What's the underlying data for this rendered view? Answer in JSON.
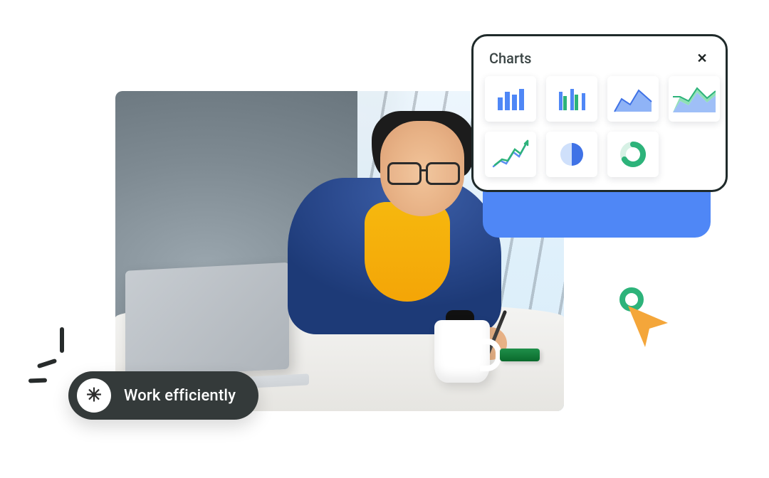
{
  "pill": {
    "label": "Work efficiently",
    "icon": "asterisk-icon",
    "icon_glyph": "✳"
  },
  "charts_panel": {
    "title": "Charts",
    "close_glyph": "✕",
    "items": [
      {
        "name": "bar-chart-icon"
      },
      {
        "name": "grouped-bar-chart-icon"
      },
      {
        "name": "area-chart-icon"
      },
      {
        "name": "stacked-area-chart-icon"
      },
      {
        "name": "line-trend-icon"
      },
      {
        "name": "pie-chart-icon"
      },
      {
        "name": "donut-chart-icon"
      }
    ]
  },
  "colors": {
    "accent_blue": "#4f87f6",
    "accent_green": "#2db37a",
    "cursor_orange": "#f4a63a",
    "panel_border": "#1f2a2a",
    "pill_bg": "#343a3a"
  }
}
